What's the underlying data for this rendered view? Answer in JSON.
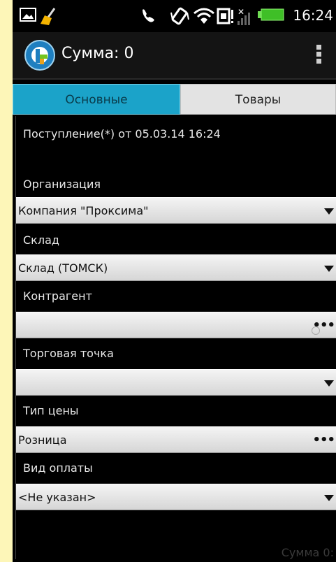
{
  "statusbar": {
    "time": "16:24",
    "icons": [
      "image-icon",
      "cleaner-icon",
      "call-icon",
      "vibrate-icon",
      "wifi-icon",
      "sim-icon",
      "no-signal-icon",
      "battery-icon"
    ]
  },
  "actionbar": {
    "title": "Сумма: 0",
    "logo_icon": "app-logo-icon",
    "overflow_icon": "overflow-menu-icon"
  },
  "tabs": [
    {
      "label": "Основные",
      "active": true
    },
    {
      "label": "Товары",
      "active": false
    }
  ],
  "document": {
    "title": "Поступление(*) от 05.03.14 16:24"
  },
  "fields": {
    "organization": {
      "label": "Организация",
      "value": "Компания \"Проксима\"",
      "control": "dropdown"
    },
    "warehouse": {
      "label": "Склад",
      "value": "Склад (ТОМСК)",
      "control": "dropdown"
    },
    "contractor": {
      "label": "Контрагент",
      "value": "",
      "control": "picker"
    },
    "trade_point": {
      "label": "Торговая точка",
      "value": "",
      "control": "dropdown"
    },
    "price_type": {
      "label": "Тип цены",
      "value": "Розница",
      "control": "picker"
    },
    "payment_type": {
      "label": "Вид оплаты",
      "value": "<Не указан>",
      "control": "dropdown"
    }
  },
  "footer": {
    "partial_sum": "Сумма 0:"
  },
  "colors": {
    "tab_active": "#1ba3c9",
    "tab_inactive": "#e3e3e3",
    "background": "#000000",
    "page_bg": "#fdf6b8"
  }
}
